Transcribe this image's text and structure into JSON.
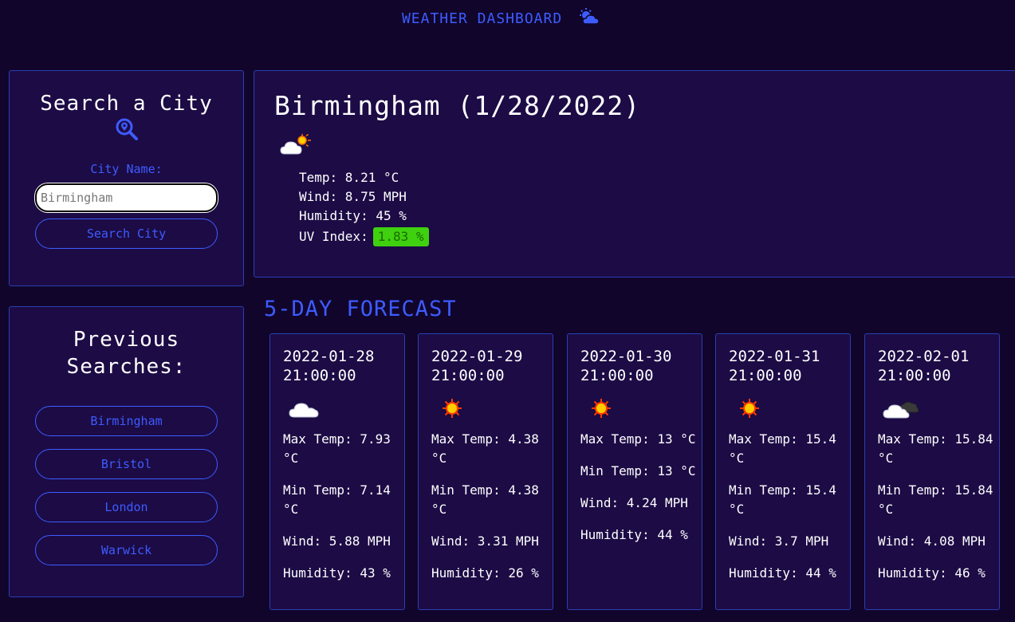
{
  "header": {
    "title": "WEATHER DASHBOARD",
    "icon": "sun-behind-cloud-icon"
  },
  "search": {
    "heading": "Search a City",
    "label": "City Name:",
    "placeholder": "Birmingham",
    "button": "Search City"
  },
  "history": {
    "heading_line1": "Previous",
    "heading_line2": "Searches:",
    "items": [
      {
        "label": "Birmingham"
      },
      {
        "label": "Bristol"
      },
      {
        "label": "London"
      },
      {
        "label": "Warwick"
      }
    ]
  },
  "current": {
    "title": "Birmingham (1/28/2022)",
    "icon": "sun-behind-cloud-icon",
    "temp_label": "Temp: ",
    "temp": "8.21 °C",
    "wind_label": "Wind: ",
    "wind": "8.75 MPH",
    "humidity_label": "Humidity: ",
    "humidity": "45 %",
    "uv_label": "UV Index:",
    "uv": "1.83 %",
    "uv_color": "#3fd10f"
  },
  "forecast": {
    "heading": "5-DAY FORECAST",
    "days": [
      {
        "date": "2022-01-28 21:00:00",
        "icon": "cloud-icon",
        "max": "Max Temp: 7.93 °C",
        "min": "Min Temp: 7.14 °C",
        "wind": "Wind: 5.88 MPH",
        "humidity": "Humidity: 43 %"
      },
      {
        "date": "2022-01-29 21:00:00",
        "icon": "sun-icon",
        "max": "Max Temp: 4.38 °C",
        "min": "Min Temp: 4.38 °C",
        "wind": "Wind: 3.31 MPH",
        "humidity": "Humidity: 26 %"
      },
      {
        "date": "2022-01-30 21:00:00",
        "icon": "sun-icon",
        "max": "Max Temp: 13 °C",
        "min": "Min Temp: 13 °C",
        "wind": "Wind: 4.24 MPH",
        "humidity": "Humidity: 44 %"
      },
      {
        "date": "2022-01-31 21:00:00",
        "icon": "sun-icon",
        "max": "Max Temp: 15.4 °C",
        "min": "Min Temp: 15.4 °C",
        "wind": "Wind: 3.7 MPH",
        "humidity": "Humidity: 44 %"
      },
      {
        "date": "2022-02-01 21:00:00",
        "icon": "cloud-icon",
        "max": "Max Temp: 15.84 °C",
        "min": "Min Temp: 15.84 °C",
        "wind": "Wind: 4.08 MPH",
        "humidity": "Humidity: 46 %"
      }
    ]
  },
  "colors": {
    "accent": "#3d5cff",
    "background": "#11052c",
    "panel": "#1c0b45"
  }
}
